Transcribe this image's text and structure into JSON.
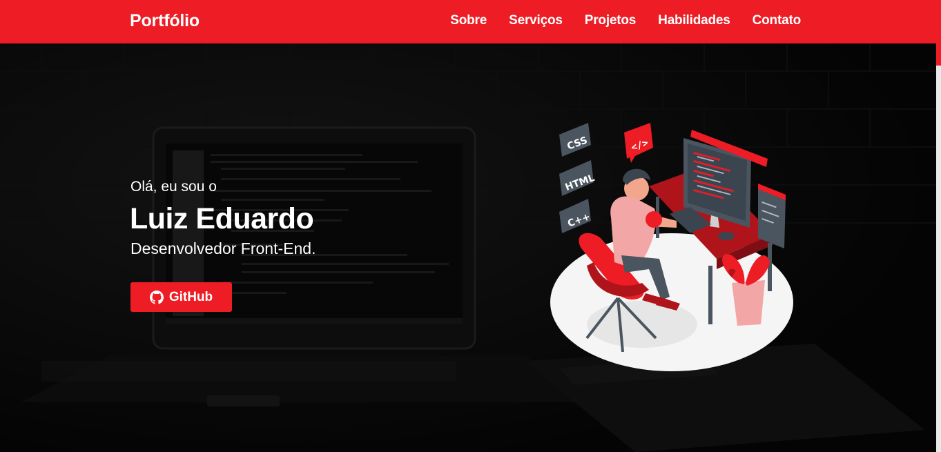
{
  "navbar": {
    "brand": "Portfólio",
    "links": [
      "Sobre",
      "Serviços",
      "Projetos",
      "Habilidades",
      "Contato"
    ]
  },
  "hero": {
    "greeting": "Olá, eu sou o",
    "name": "Luiz Eduardo",
    "role": "Desenvolvedor Front-End.",
    "button_label": "GitHub"
  },
  "illustration": {
    "badges": [
      "CSS",
      "HTML",
      "C++"
    ],
    "code_tag": "</>"
  },
  "colors": {
    "accent": "#ee1c25",
    "background": "#0b0b0b",
    "text": "#ffffff"
  }
}
